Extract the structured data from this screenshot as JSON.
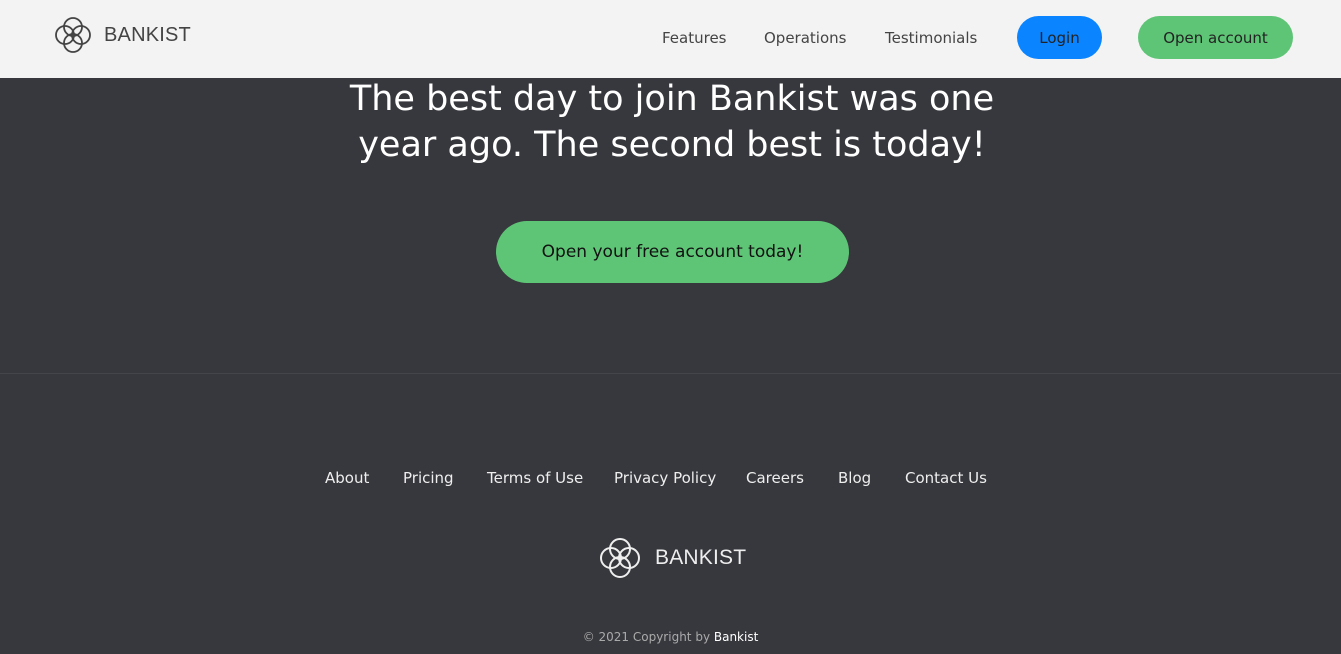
{
  "nav": {
    "brand": "BANKIST",
    "logo_icon": "bankist-logo-icon",
    "links": [
      "Features",
      "Operations",
      "Testimonials"
    ],
    "login_label": "Login",
    "open_account_label": "Open account"
  },
  "signup": {
    "headline_line1": "The best day to join Bankist was one",
    "headline_line2": "year ago. The second best is today!",
    "cta_label": "Open your free account today!"
  },
  "footer": {
    "links": [
      "About",
      "Pricing",
      "Terms of Use",
      "Privacy Policy",
      "Careers",
      "Blog",
      "Contact Us"
    ],
    "brand": "BANKIST",
    "copyright_prefix": "© 2021 Copyright by ",
    "copyright_brand": "Bankist"
  },
  "colors": {
    "nav_background": "#f3f3f3",
    "page_background": "#37383d",
    "login_button": "#0a84ff",
    "green_button": "#5ec576"
  }
}
